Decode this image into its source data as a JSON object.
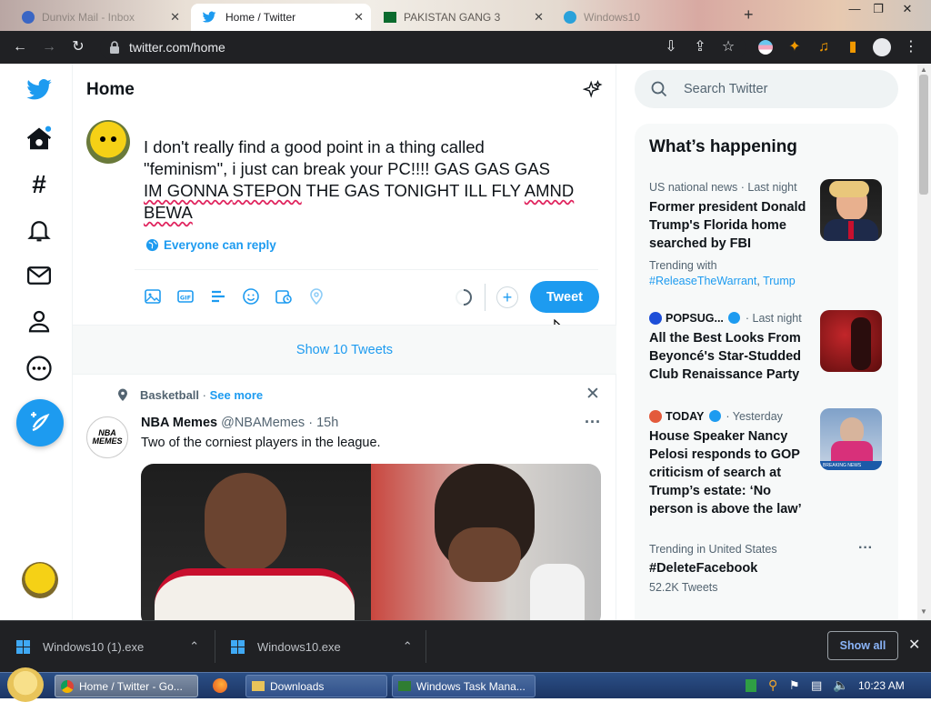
{
  "browser": {
    "tabs": [
      {
        "title": "Dunvix Mail - Inbox",
        "active": false
      },
      {
        "title": "Home / Twitter",
        "active": true
      },
      {
        "title": "PAKISTAN GANG 3",
        "active": false
      },
      {
        "title": "Windows10",
        "active": false
      }
    ],
    "url": "twitter.com/home",
    "window_controls": {
      "min": "—",
      "max": "❐",
      "close": "✕"
    }
  },
  "timeline": {
    "title": "Home",
    "compose": {
      "text_lines": [
        "I don't really find a good point in a thing called",
        "\"feminism\", i just can break your PC!!!! GAS GAS GAS"
      ],
      "line3_parts": [
        "IM GONNA ",
        "STEPON",
        " THE GAS TONIGHT ILL FLY ",
        "AMND"
      ],
      "line4_parts": [
        "",
        "BEWA"
      ],
      "reply_setting": "Everyone can reply",
      "tweet_button": "Tweet"
    },
    "show_tweets": "Show 10 Tweets",
    "topic": {
      "label": "Basketball",
      "sep": " · ",
      "see_more": "See more"
    },
    "tweet": {
      "name": "NBA Memes",
      "handle": "@NBAMemes",
      "sep": " · ",
      "time": "15h",
      "text": "Two of the corniest players in the league.",
      "avatar_text": "NBA\nMEMES"
    }
  },
  "sidebar": {
    "search_placeholder": "Search Twitter",
    "trends_title": "What’s happening",
    "trends": [
      {
        "meta": "US national news · Last night",
        "headline": "Former president Donald Trump's Florida home searched by FBI",
        "trending_label": "Trending with",
        "hashtags": [
          "#ReleaseTheWarrant",
          "Trump"
        ]
      },
      {
        "source": "POPSUG...",
        "meta_tail": " · Last night",
        "headline": "All the Best Looks From Beyoncé's Star-Studded Club Renaissance Party"
      },
      {
        "source": "TODAY",
        "meta_tail": " · Yesterday",
        "headline": "House Speaker Nancy Pelosi responds to GOP criticism of search at Trump’s estate: ‘No person is above the law’",
        "thumb_caption": "BREAKING NEWS"
      },
      {
        "meta": "Trending in United States",
        "headline": "#DeleteFacebook",
        "count": "52.2K Tweets"
      }
    ]
  },
  "downloads": {
    "items": [
      "Windows10 (1).exe",
      "Windows10.exe"
    ],
    "show_all": "Show all"
  },
  "taskbar": {
    "tasks": [
      "Home / Twitter - Go...",
      "Downloads",
      "Windows Task Mana..."
    ],
    "clock": "10:23 AM"
  },
  "colors": {
    "accent": "#1d9bf0",
    "chrome_dark": "#202124",
    "taskbar": "#1c3564"
  }
}
